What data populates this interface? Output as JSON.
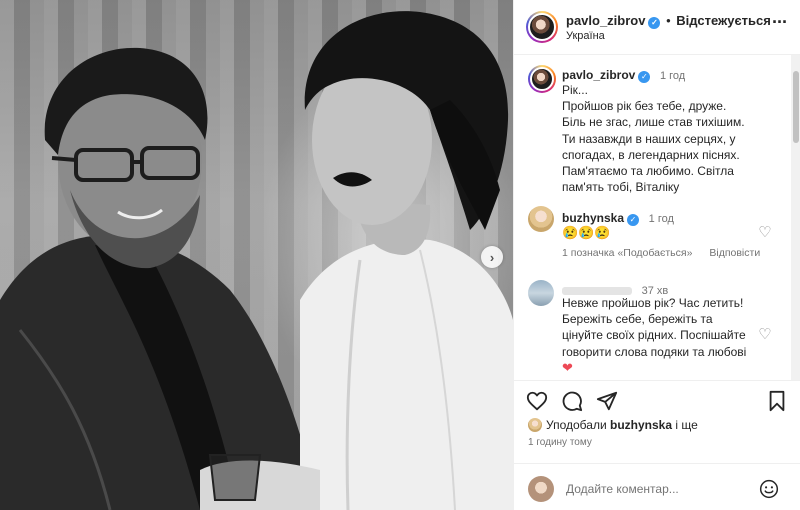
{
  "header": {
    "username": "pavlo_zibrov",
    "follow_label": "Відстежується",
    "location": "Україна"
  },
  "caption": {
    "username": "pavlo_zibrov",
    "time": "1 год",
    "lines": [
      "Рік...",
      "Пройшов рік без тебе, друже.",
      "Біль не згас, лише став тихішим.",
      "Ти назавжди в наших серцях, у",
      "спогадах, в легендарних піснях.",
      "Пам'ятаємо та любимо. Світла",
      "пам'ять тобі, Віталіку"
    ]
  },
  "comments": [
    {
      "username": "buzhynska",
      "time": "1 год",
      "text": "😢😢😢",
      "likes_label": "1 позначка «Подобається»",
      "reply_label": "Відповісти"
    },
    {
      "username": "",
      "time": "37 хв",
      "lines": [
        "Невже пройшов рік? Час летить!",
        "Бережіть себе, бережіть та",
        "цінуйте своїх рідних. Поспішайте",
        "говорити слова подяки та любові"
      ],
      "emoji": "❤"
    }
  ],
  "likes": {
    "prefix": "Уподобали",
    "user": "buzhynska",
    "suffix": "і ще"
  },
  "post_time": "1 годину тому",
  "add_comment": {
    "placeholder": "Додайте коментар..."
  },
  "icons": {
    "like": "heart-outline-icon",
    "comment": "comment-bubble-icon",
    "share": "paper-plane-icon",
    "save": "bookmark-icon",
    "emoji": "smiley-icon",
    "more": "more-dots-icon",
    "next": "chevron-right-icon"
  },
  "colors": {
    "verified": "#3897f0",
    "secondary_text": "#737373",
    "heart_red": "#ed4956"
  }
}
